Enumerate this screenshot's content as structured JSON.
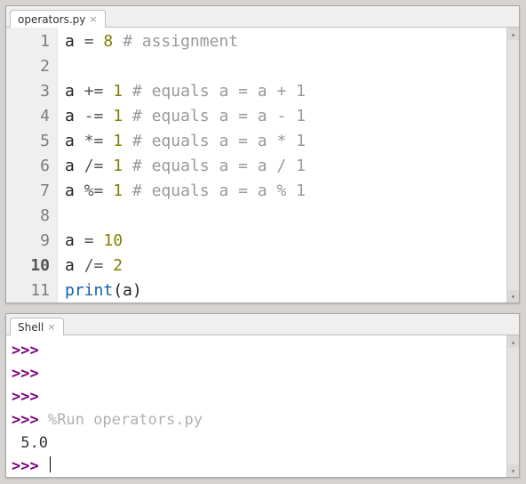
{
  "editor": {
    "tab_label": "operators.py",
    "line_numbers": [
      "1",
      "2",
      "3",
      "4",
      "5",
      "6",
      "7",
      "8",
      "9",
      "10",
      "11"
    ],
    "bold_line": "10",
    "code": [
      [
        {
          "t": "a ",
          "c": "tok-var"
        },
        {
          "t": "=",
          "c": "tok-op"
        },
        {
          "t": " ",
          "c": "tok-var"
        },
        {
          "t": "8",
          "c": "tok-num"
        },
        {
          "t": " ",
          "c": "tok-var"
        },
        {
          "t": "# assignment",
          "c": "tok-cmt"
        }
      ],
      [],
      [
        {
          "t": "a ",
          "c": "tok-var"
        },
        {
          "t": "+=",
          "c": "tok-op"
        },
        {
          "t": " ",
          "c": "tok-var"
        },
        {
          "t": "1",
          "c": "tok-num"
        },
        {
          "t": " ",
          "c": "tok-var"
        },
        {
          "t": "# equals a = a + 1",
          "c": "tok-cmt"
        }
      ],
      [
        {
          "t": "a ",
          "c": "tok-var"
        },
        {
          "t": "-=",
          "c": "tok-op"
        },
        {
          "t": " ",
          "c": "tok-var"
        },
        {
          "t": "1",
          "c": "tok-num"
        },
        {
          "t": " ",
          "c": "tok-var"
        },
        {
          "t": "# equals a = a - 1",
          "c": "tok-cmt"
        }
      ],
      [
        {
          "t": "a ",
          "c": "tok-var"
        },
        {
          "t": "*=",
          "c": "tok-op"
        },
        {
          "t": " ",
          "c": "tok-var"
        },
        {
          "t": "1",
          "c": "tok-num"
        },
        {
          "t": " ",
          "c": "tok-var"
        },
        {
          "t": "# equals a = a * 1",
          "c": "tok-cmt"
        }
      ],
      [
        {
          "t": "a ",
          "c": "tok-var"
        },
        {
          "t": "/=",
          "c": "tok-op"
        },
        {
          "t": " ",
          "c": "tok-var"
        },
        {
          "t": "1",
          "c": "tok-num"
        },
        {
          "t": " ",
          "c": "tok-var"
        },
        {
          "t": "# equals a = a / 1",
          "c": "tok-cmt"
        }
      ],
      [
        {
          "t": "a ",
          "c": "tok-var"
        },
        {
          "t": "%=",
          "c": "tok-op"
        },
        {
          "t": " ",
          "c": "tok-var"
        },
        {
          "t": "1",
          "c": "tok-num"
        },
        {
          "t": " ",
          "c": "tok-var"
        },
        {
          "t": "# equals a = a % 1",
          "c": "tok-cmt"
        }
      ],
      [],
      [
        {
          "t": "a ",
          "c": "tok-var"
        },
        {
          "t": "=",
          "c": "tok-op"
        },
        {
          "t": " ",
          "c": "tok-var"
        },
        {
          "t": "10",
          "c": "tok-num"
        }
      ],
      [
        {
          "t": "a ",
          "c": "tok-var"
        },
        {
          "t": "/=",
          "c": "tok-op"
        },
        {
          "t": " ",
          "c": "tok-var"
        },
        {
          "t": "2",
          "c": "tok-num"
        }
      ],
      [
        {
          "t": "print",
          "c": "tok-fn"
        },
        {
          "t": "(a)",
          "c": "tok-var"
        }
      ]
    ]
  },
  "shell": {
    "tab_label": "Shell",
    "lines": [
      {
        "prompt": ">>>",
        "text": "",
        "cls": ""
      },
      {
        "prompt": ">>>",
        "text": "",
        "cls": ""
      },
      {
        "prompt": ">>>",
        "text": "",
        "cls": ""
      },
      {
        "prompt": ">>>",
        "text": " %Run operators.py",
        "cls": "magic"
      },
      {
        "prompt": "",
        "text": " 5.0",
        "cls": "out"
      },
      {
        "prompt": ">>>",
        "text": " ",
        "cls": "",
        "cursor": true
      }
    ]
  }
}
